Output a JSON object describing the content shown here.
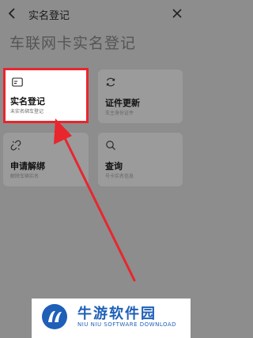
{
  "nav": {
    "title": "实名登记"
  },
  "headline": "车联网卡实名登记",
  "cards": [
    {
      "label": "实名登记",
      "sub": "未实名绑车登记",
      "icon": "id-card-icon"
    },
    {
      "label": "证件更新",
      "sub": "车主身份证件",
      "icon": "refresh-icon"
    },
    {
      "label": "申请解绑",
      "sub": "解除车辆实名",
      "icon": "unlink-icon"
    },
    {
      "label": "查询",
      "sub": "号卡实名信息",
      "icon": "search-icon"
    }
  ],
  "watermark": {
    "name": "牛游软件园",
    "english": "NIU NIU SOFTWARE DOWNLOAD"
  },
  "colors": {
    "highlight": "#e8262e",
    "watermark_blue": "#1e5fb8"
  }
}
